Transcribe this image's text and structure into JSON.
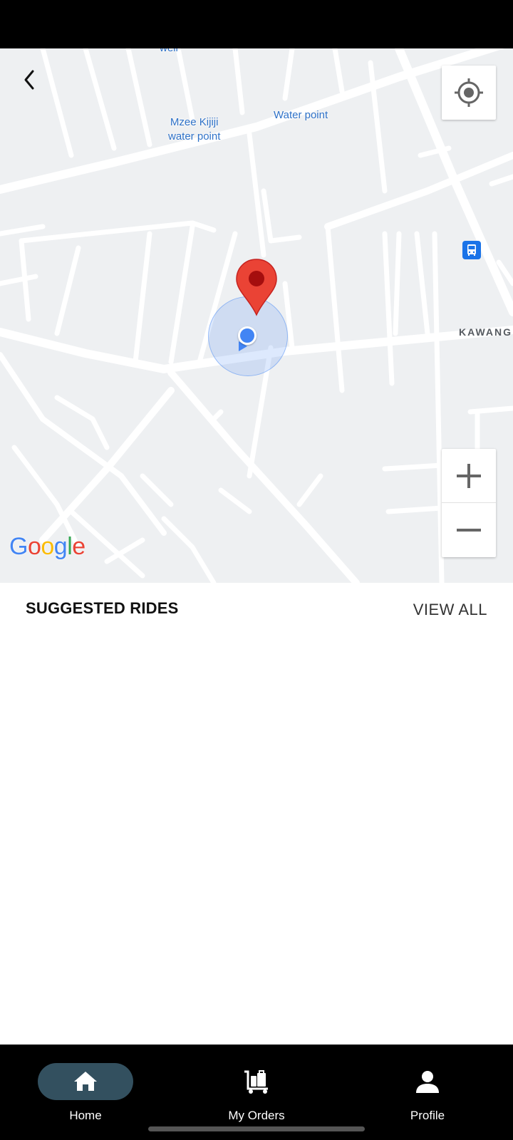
{
  "map": {
    "poi_labels": [
      "well",
      "Mzee Kijiji\nwater point",
      "Water point"
    ],
    "street_label": "KAWANG",
    "attribution": "Google",
    "icons": {
      "back": "chevron-left-icon",
      "locate": "my-location-icon",
      "transit": "bus-stop-icon",
      "zoom_in": "plus-icon",
      "zoom_out": "minus-icon",
      "pin": "map-pin-icon"
    },
    "colors": {
      "pin": "#ea4335",
      "my_location": "#4285f4"
    }
  },
  "suggested": {
    "title": "SUGGESTED RIDES",
    "view_all": "VIEW ALL"
  },
  "nav": {
    "items": [
      {
        "label": "Home",
        "icon": "home-icon",
        "active": true
      },
      {
        "label": "My Orders",
        "icon": "luggage-cart-icon",
        "active": false
      },
      {
        "label": "Profile",
        "icon": "person-icon",
        "active": false
      }
    ],
    "active_color": "#33505f"
  }
}
